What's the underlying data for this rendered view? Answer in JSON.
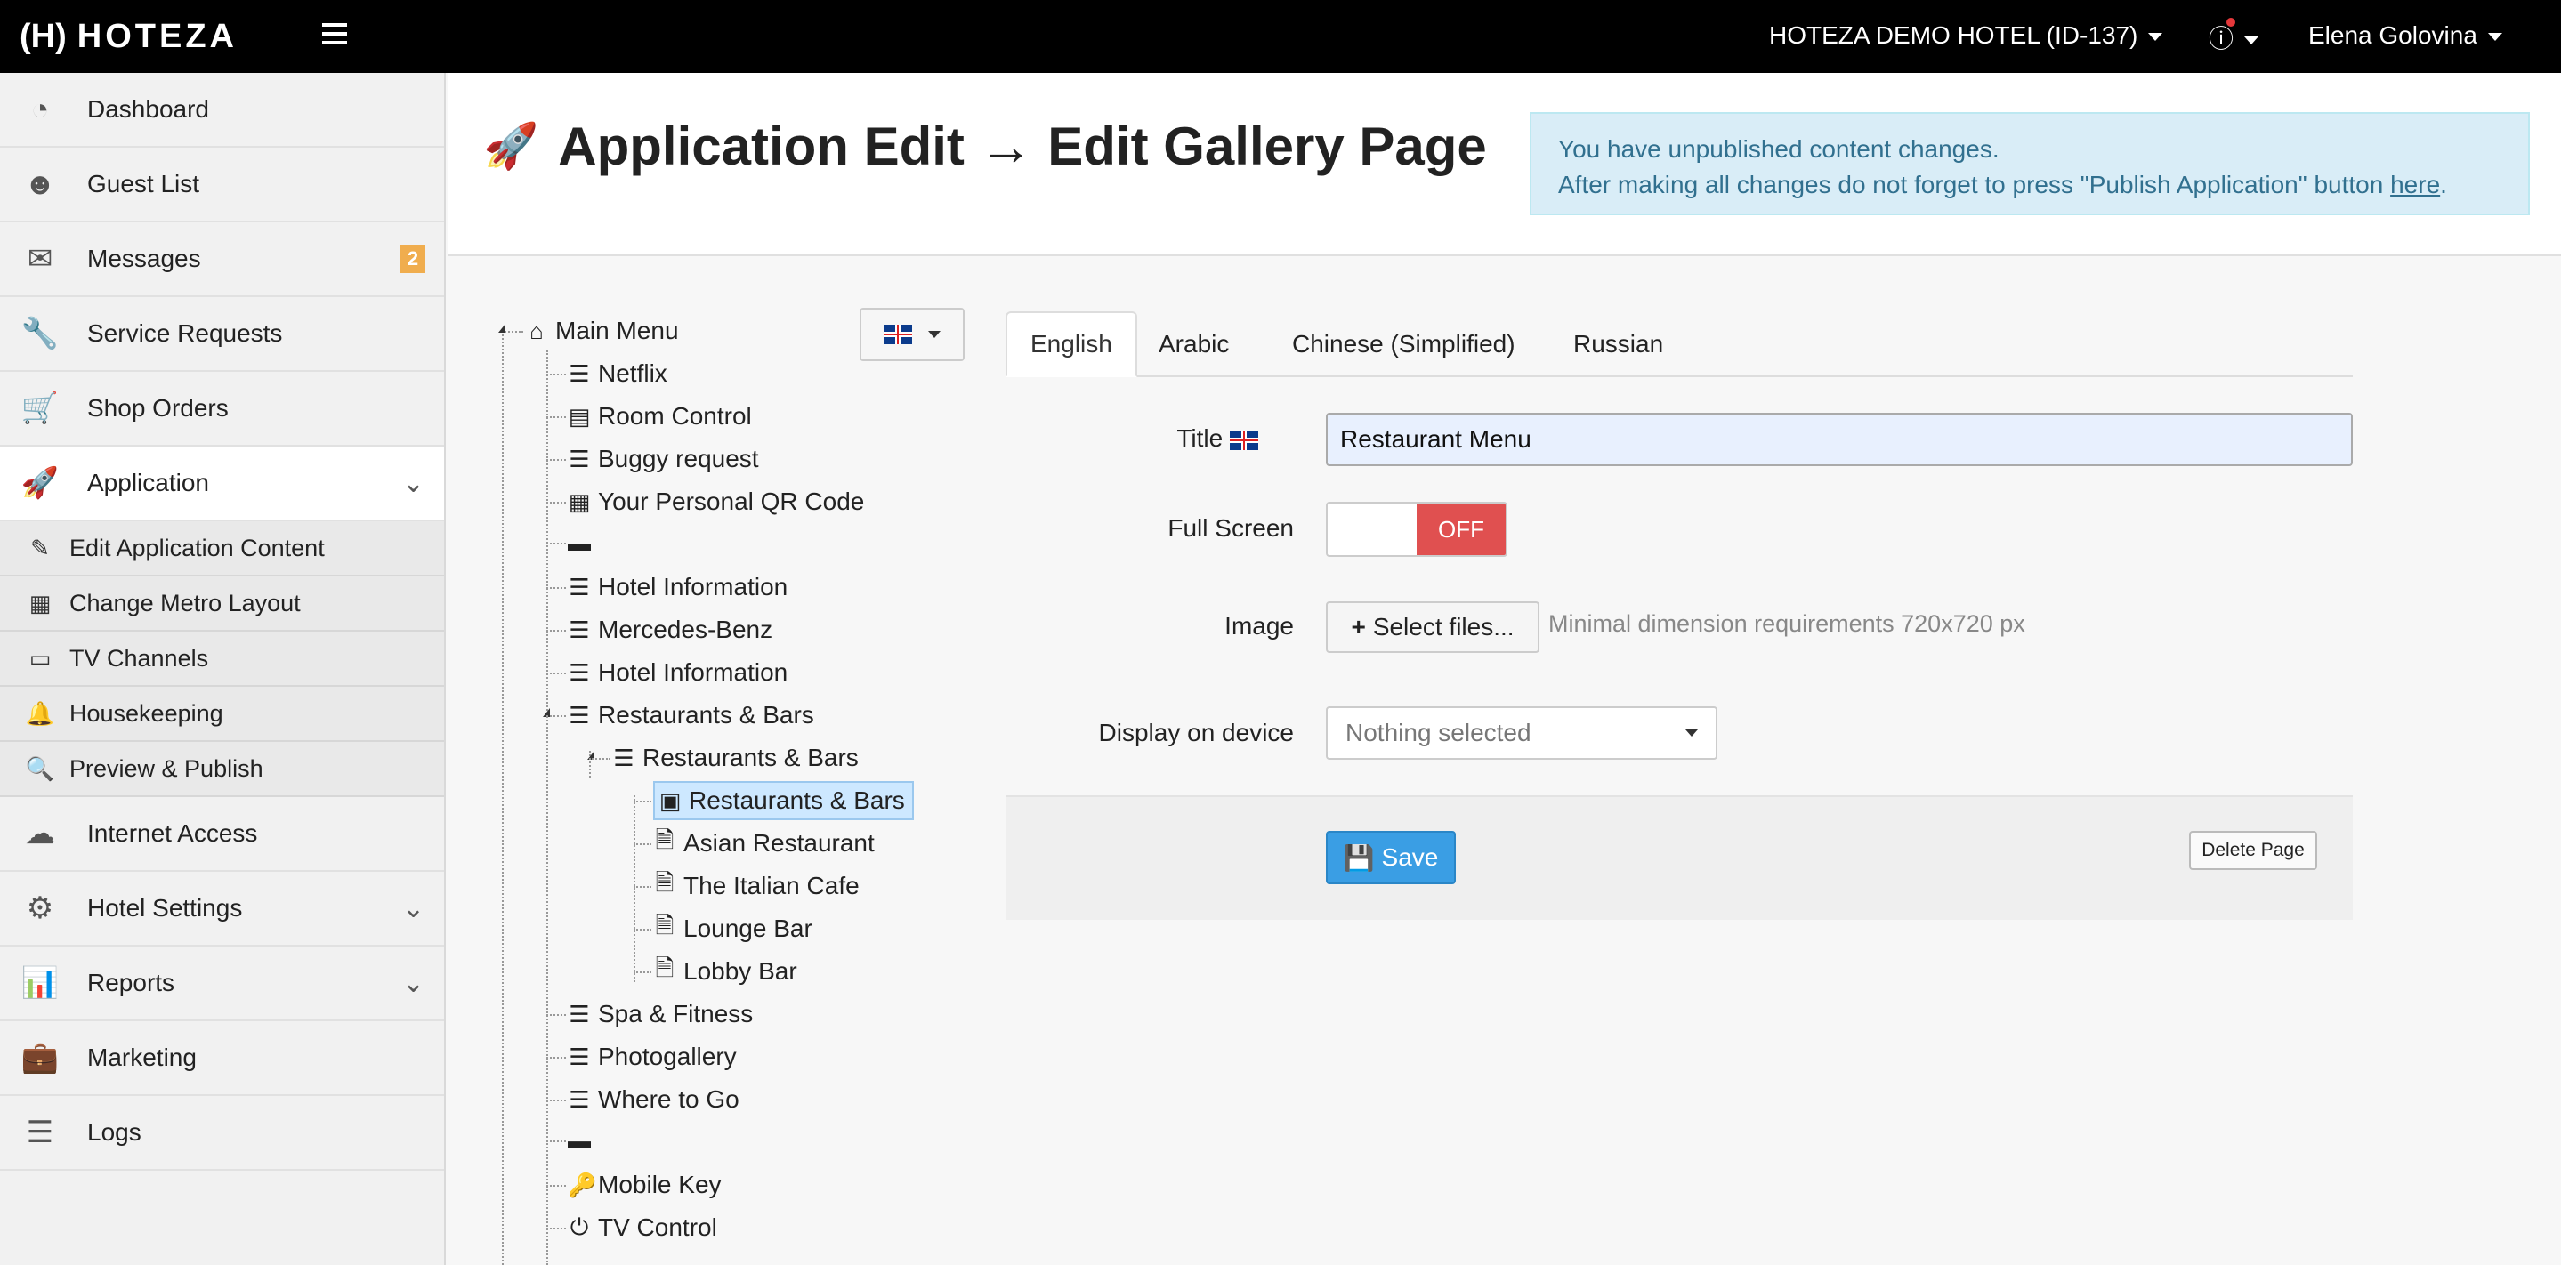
{
  "topbar": {
    "logo_mark": "(H)",
    "logo_text": "HOTEZA",
    "hotel": "HOTEZA DEMO HOTEL (ID-137)",
    "user": "Elena Golovina"
  },
  "sidebar": {
    "items": [
      {
        "label": "Dashboard",
        "icon": "dashboard-icon"
      },
      {
        "label": "Guest List",
        "icon": "users-icon"
      },
      {
        "label": "Messages",
        "icon": "comments-icon",
        "badge": "2"
      },
      {
        "label": "Service Requests",
        "icon": "wrench-icon"
      },
      {
        "label": "Shop Orders",
        "icon": "cart-icon"
      },
      {
        "label": "Application",
        "icon": "rocket-icon"
      }
    ],
    "sub_items": [
      {
        "label": "Edit Application Content",
        "icon": "edit-icon"
      },
      {
        "label": "Change Metro Layout",
        "icon": "grid-icon"
      },
      {
        "label": "TV Channels",
        "icon": "monitor-icon"
      },
      {
        "label": "Housekeeping",
        "icon": "bell-icon"
      },
      {
        "label": "Preview & Publish",
        "icon": "search-plus-icon"
      }
    ],
    "items_after": [
      {
        "label": "Internet Access",
        "icon": "cloud-icon"
      },
      {
        "label": "Hotel Settings",
        "icon": "gears-icon"
      },
      {
        "label": "Reports",
        "icon": "bar-chart-icon"
      },
      {
        "label": "Marketing",
        "icon": "briefcase-icon"
      },
      {
        "label": "Logs",
        "icon": "list-icon"
      }
    ]
  },
  "header": {
    "title": "Application Edit → Edit Gallery Page",
    "alert_line1": "You have unpublished content changes.",
    "alert_line2_prefix": "After making all changes do not forget to press \"Publish Application\" button ",
    "alert_link": "here",
    "alert_line2_suffix": "."
  },
  "tree": {
    "root": "Main Menu",
    "nodes": [
      {
        "label": "Netflix",
        "icon": "list-icon"
      },
      {
        "label": "Room Control",
        "icon": "sliders-icon"
      },
      {
        "label": "Buggy request",
        "icon": "list-icon"
      },
      {
        "label": "Your Personal QR Code",
        "icon": "qrcode-icon"
      },
      {
        "label": "",
        "icon": "separator-icon"
      },
      {
        "label": "Hotel Information",
        "icon": "list-icon"
      },
      {
        "label": "Mercedes-Benz",
        "icon": "list-icon"
      },
      {
        "label": "Hotel Information",
        "icon": "list-icon"
      },
      {
        "label": "Restaurants & Bars",
        "icon": "list-icon"
      },
      {
        "label": "Restaurants & Bars",
        "icon": "list-ul-icon"
      },
      {
        "label": "Restaurants & Bars",
        "icon": "image-icon"
      },
      {
        "label": "Asian Restaurant",
        "icon": "file-icon"
      },
      {
        "label": "The Italian Cafe",
        "icon": "file-icon"
      },
      {
        "label": "Lounge Bar",
        "icon": "file-icon"
      },
      {
        "label": "Lobby Bar",
        "icon": "file-icon"
      },
      {
        "label": "Spa & Fitness",
        "icon": "list-icon"
      },
      {
        "label": "Photogallery",
        "icon": "list-icon"
      },
      {
        "label": "Where to Go",
        "icon": "list-icon"
      },
      {
        "label": "",
        "icon": "separator-icon"
      },
      {
        "label": "Mobile Key",
        "icon": "key-icon"
      },
      {
        "label": "TV Control",
        "icon": "power-icon"
      }
    ]
  },
  "tabs": [
    "English",
    "Arabic",
    "Chinese (Simplified)",
    "Russian"
  ],
  "form": {
    "title_label": "Title",
    "title_value": "Restaurant Menu",
    "fullscreen_label": "Full Screen",
    "fullscreen_state": "OFF",
    "image_label": "Image",
    "select_files": "Select files...",
    "image_hint": "Minimal dimension requirements 720x720 px",
    "device_label": "Display on device",
    "device_value": "Nothing selected",
    "save": "Save",
    "delete": "Delete Page"
  }
}
